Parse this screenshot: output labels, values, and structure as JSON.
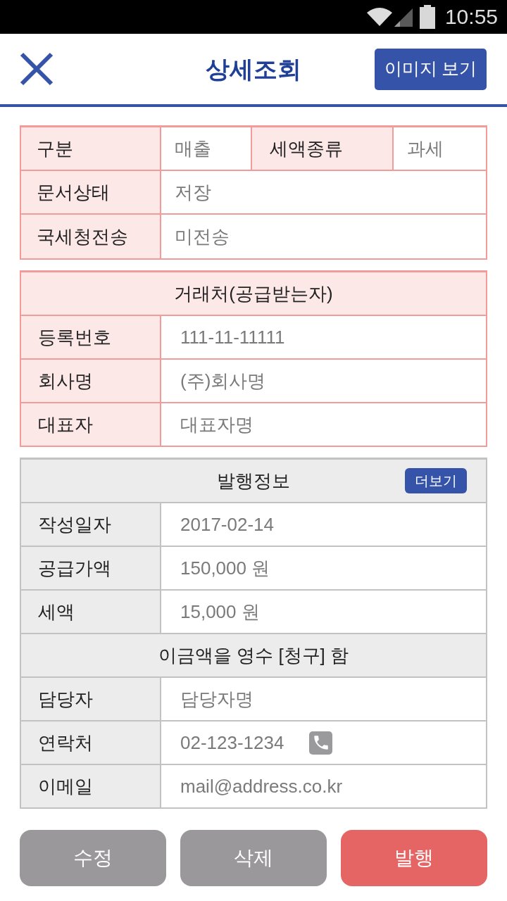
{
  "status_bar": {
    "time": "10:55"
  },
  "header": {
    "title": "상세조회",
    "image_button": "이미지 보기"
  },
  "document_info": {
    "rows": [
      {
        "fields": [
          {
            "label": "구분",
            "value": "매출"
          },
          {
            "label": "세액종류",
            "value": "과세"
          }
        ]
      },
      {
        "fields": [
          {
            "label": "문서상태",
            "value": "저장"
          }
        ]
      },
      {
        "fields": [
          {
            "label": "국세청전송",
            "value": "미전송"
          }
        ]
      }
    ]
  },
  "customer": {
    "title": "거래처(공급받는자)",
    "rows": [
      {
        "label": "등록번호",
        "value": "111-11-11111"
      },
      {
        "label": "회사명",
        "value": "(주)회사명"
      },
      {
        "label": "대표자",
        "value": "대표자명"
      }
    ]
  },
  "issue_info": {
    "title": "발행정보",
    "more_button": "더보기",
    "rows": [
      {
        "kind": "field",
        "label": "작성일자",
        "value": "2017-02-14"
      },
      {
        "kind": "field",
        "label": "공급가액",
        "value": "150,000 원"
      },
      {
        "kind": "field",
        "label": "세액",
        "value": "15,000 원"
      },
      {
        "kind": "notice",
        "text": "이금액을 영수 [청구] 함"
      },
      {
        "kind": "field",
        "label": "담당자",
        "value": "담당자명"
      },
      {
        "kind": "phone",
        "label": "연락처",
        "value": "02-123-1234"
      },
      {
        "kind": "field",
        "label": "이메일",
        "value": "mail@address.co.kr"
      }
    ]
  },
  "actions": [
    {
      "kind": "neutral",
      "label": "수정"
    },
    {
      "kind": "neutral",
      "label": "삭제"
    },
    {
      "kind": "danger",
      "label": "발행"
    }
  ]
}
